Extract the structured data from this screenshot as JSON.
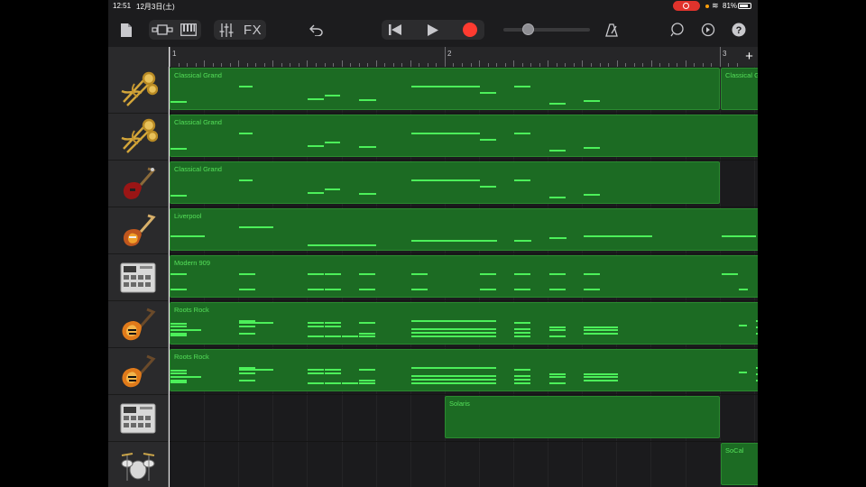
{
  "status_bar": {
    "time": "12:51",
    "date": "12月3日(土)",
    "battery": "81%"
  },
  "toolbar": {
    "fx_label": "FX",
    "icons": [
      "document-icon",
      "track-view-icon",
      "keyboard-icon",
      "mixer-icon",
      "undo-icon",
      "rewind-icon",
      "play-icon",
      "record-icon",
      "metronome-icon",
      "loop-icon",
      "settings-icon",
      "help-icon"
    ]
  },
  "ruler": {
    "bars": [
      "1",
      "2",
      "3"
    ]
  },
  "tracks": [
    {
      "instrument": "brass",
      "icon": "brass-icon",
      "regions": [
        {
          "name": "Classical Grand",
          "start": 0,
          "end": 610
        },
        {
          "name": "Classical Grand",
          "start": 611,
          "end": 660
        }
      ]
    },
    {
      "instrument": "brass",
      "icon": "brass-icon",
      "regions": [
        {
          "name": "Classical Grand",
          "start": 0,
          "end": 660
        }
      ]
    },
    {
      "instrument": "bass",
      "icon": "red-bass-icon",
      "regions": [
        {
          "name": "Classical Grand",
          "start": 0,
          "end": 610
        }
      ]
    },
    {
      "instrument": "bass",
      "icon": "sunburst-bass-icon",
      "regions": [
        {
          "name": "Liverpool",
          "start": 0,
          "end": 660
        }
      ]
    },
    {
      "instrument": "drum-machine",
      "icon": "drum-machine-icon",
      "regions": [
        {
          "name": "Modern 909",
          "start": 0,
          "end": 660
        }
      ]
    },
    {
      "instrument": "electric-guitar",
      "icon": "guitar-icon",
      "regions": [
        {
          "name": "Roots Rock",
          "start": 0,
          "end": 660
        }
      ]
    },
    {
      "instrument": "electric-guitar",
      "icon": "guitar-icon",
      "regions": [
        {
          "name": "Roots Rock",
          "start": 0,
          "end": 660
        }
      ]
    },
    {
      "instrument": "drum-machine",
      "icon": "drum-machine-icon",
      "regions": [
        {
          "name": "Solaris",
          "start": 305,
          "end": 610
        }
      ]
    },
    {
      "instrument": "drum-kit",
      "icon": "drum-kit-icon",
      "regions": [
        {
          "name": "SoCal",
          "start": 611,
          "end": 660
        }
      ]
    }
  ],
  "colors": {
    "region_fill": "#1c6b23",
    "note": "#4cf05a",
    "record": "#ff3b30",
    "label": "#55e05a"
  }
}
